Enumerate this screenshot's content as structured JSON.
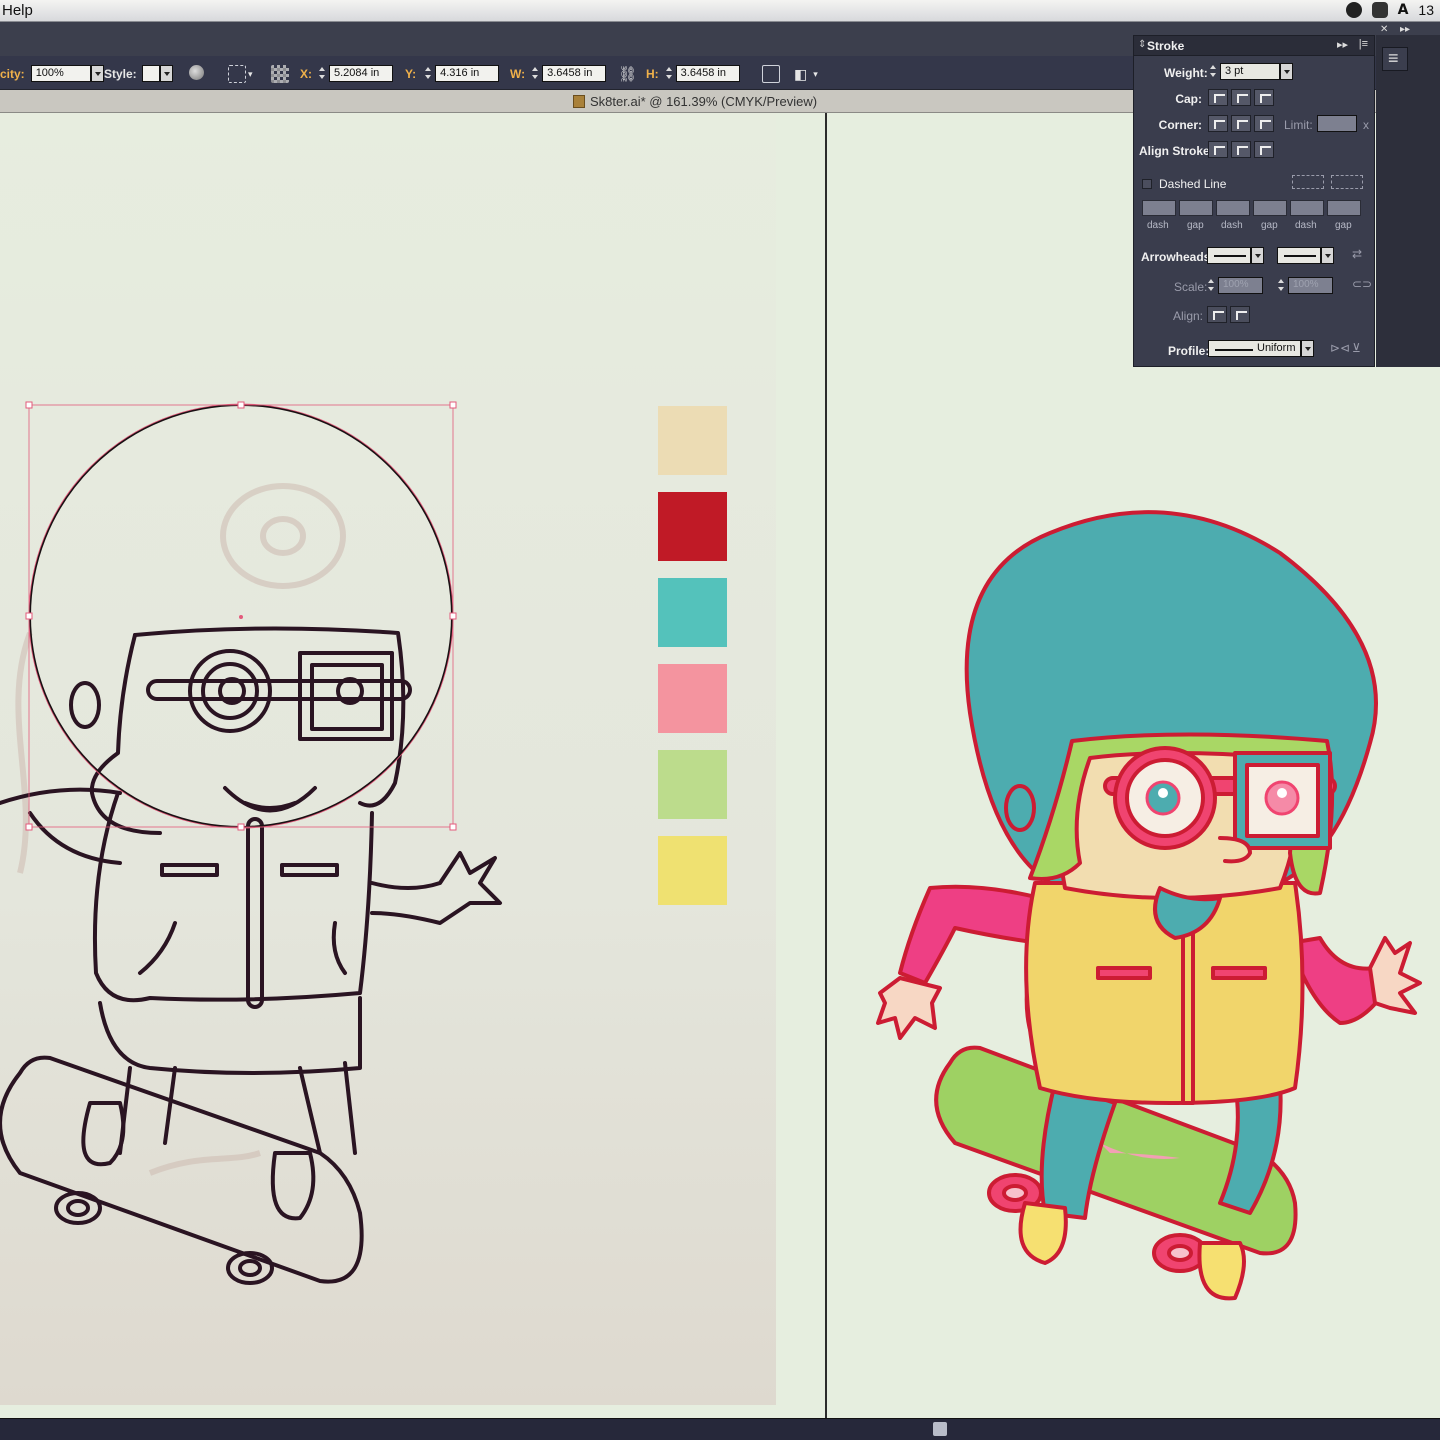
{
  "menubar": {
    "help": "Help",
    "clock": "13"
  },
  "controlbar": {
    "opacity_label": "city:",
    "opacity_value": "100%",
    "style_label": "Style:",
    "x_label": "X:",
    "x_value": "5.2084 in",
    "y_label": "Y:",
    "y_value": "4.316 in",
    "w_label": "W:",
    "w_value": "3.6458 in",
    "h_label": "H:",
    "h_value": "3.6458 in"
  },
  "document": {
    "title": "Sk8ter.ai* @ 161.39% (CMYK/Preview)"
  },
  "swatches": [
    "#ecdcb4",
    "#c01a26",
    "#54c2bb",
    "#f4949f",
    "#bcdc8c",
    "#efe171"
  ],
  "stroke_panel": {
    "title": "Stroke",
    "weight_label": "Weight:",
    "weight_value": "3 pt",
    "cap_label": "Cap:",
    "corner_label": "Corner:",
    "limit_label": "Limit:",
    "limit_suffix": "x",
    "align_stroke_label": "Align Stroke:",
    "dashed_line_label": "Dashed Line",
    "dash_gap_labels": [
      "dash",
      "gap",
      "dash",
      "gap",
      "dash",
      "gap"
    ],
    "arrowheads_label": "Arrowheads:",
    "scale_label": "Scale:",
    "scale_start": "100%",
    "scale_end": "100%",
    "align_label": "Align:",
    "profile_label": "Profile:",
    "profile_value": "Uniform"
  },
  "colors": {
    "accent_orange": "#f0b14a",
    "panel_bg": "#3a3d4d",
    "canvas_bg": "#e6eedf",
    "outline_red": "#cc1c33",
    "helmet_teal": "#4dacaf",
    "vest_yellow": "#f1d56b",
    "sleeve_pink": "#ee3f84",
    "board_green": "#9ed163"
  }
}
